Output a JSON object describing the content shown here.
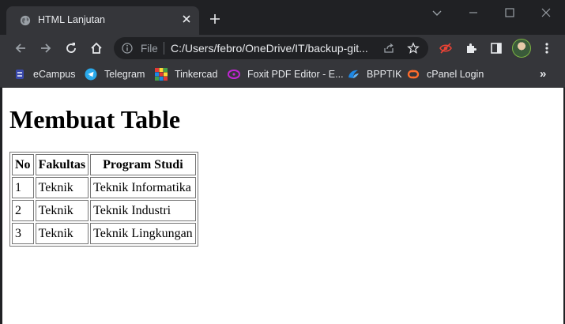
{
  "tab": {
    "title": "HTML Lanjutan",
    "favicon": "globe-icon"
  },
  "toolbar": {
    "scheme": "File",
    "url": "C:/Users/febro/OneDrive/IT/backup-git..."
  },
  "bookmarks": [
    {
      "label": "eCampus",
      "icon": "ecampus-icon"
    },
    {
      "label": "Telegram",
      "icon": "telegram-icon"
    },
    {
      "label": "Tinkercad",
      "icon": "tinkercad-icon"
    },
    {
      "label": "Foxit PDF Editor - E...",
      "icon": "foxit-icon"
    },
    {
      "label": "BPPTIK",
      "icon": "bpptik-icon"
    },
    {
      "label": "cPanel Login",
      "icon": "cpanel-icon"
    }
  ],
  "page": {
    "heading": "Membuat Table",
    "table": {
      "headers": [
        "No",
        "Fakultas",
        "Program Studi"
      ],
      "rows": [
        [
          "1",
          "Teknik",
          "Teknik Informatika"
        ],
        [
          "2",
          "Teknik",
          "Teknik Industri"
        ],
        [
          "3",
          "Teknik",
          "Teknik Lingkungan"
        ]
      ]
    }
  },
  "colors": {
    "frame": "#202124",
    "toolbar": "#35363a",
    "text_light": "#e8eaed",
    "page_bg": "#ffffff"
  }
}
